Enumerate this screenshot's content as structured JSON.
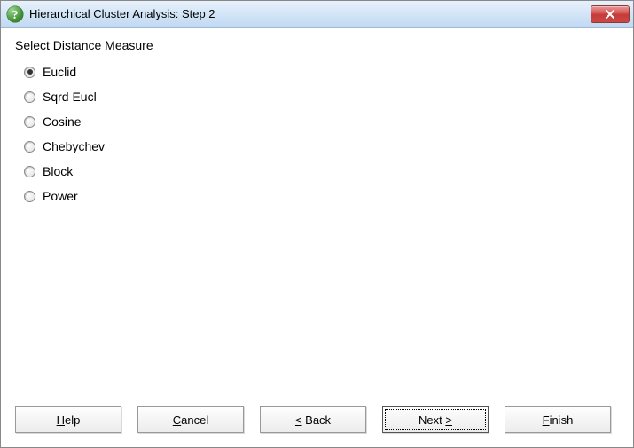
{
  "window": {
    "title": "Hierarchical Cluster Analysis: Step 2"
  },
  "content": {
    "section_label": "Select Distance Measure",
    "options": {
      "o0": "Euclid",
      "o1": "Sqrd Eucl",
      "o2": "Cosine",
      "o3": "Chebychev",
      "o4": "Block",
      "o5": "Power"
    },
    "selected_index": 0
  },
  "buttons": {
    "help_pre": "",
    "help_u": "H",
    "help_post": "elp",
    "cancel_pre": "",
    "cancel_u": "C",
    "cancel_post": "ancel",
    "back_pre": "",
    "back_u": "<",
    "back_post": " Back",
    "next_pre": "Next ",
    "next_u": ">",
    "next_post": "",
    "finish_pre": "",
    "finish_u": "F",
    "finish_post": "inish"
  }
}
